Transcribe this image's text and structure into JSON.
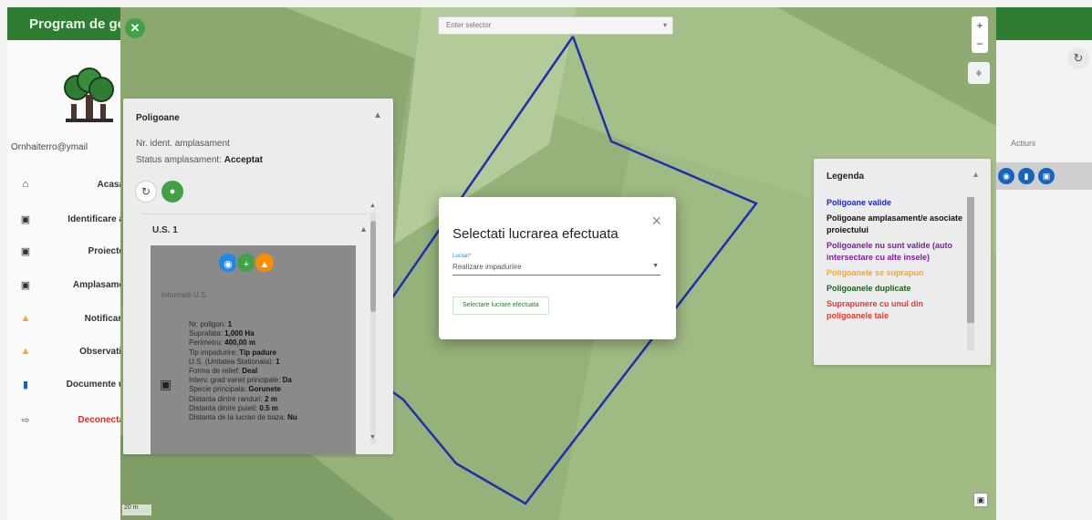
{
  "app": {
    "title": "Program de gest",
    "user_email": "Ornhaiterro@ymail",
    "refresh_icon": "refresh-icon",
    "actions_column_label": "Actiuni"
  },
  "sidebar": {
    "items": [
      {
        "label": "Acasa",
        "icon": "home-icon"
      },
      {
        "label": "Identificare a",
        "icon": "polygon-select-icon"
      },
      {
        "label": "Proiecte",
        "icon": "polygon-select-icon"
      },
      {
        "label": "Amplasame",
        "icon": "polygon-select-icon"
      },
      {
        "label": "Notificari",
        "icon": "bell-icon"
      },
      {
        "label": "Observatii",
        "icon": "warning-icon"
      },
      {
        "label": "Documente u",
        "icon": "document-icon"
      },
      {
        "label": "Deconecta",
        "icon": "logout-icon"
      }
    ]
  },
  "map": {
    "layer_select_placeholder": "Enter selector",
    "zoom_in": "+",
    "zoom_out": "−",
    "scale": "20 m",
    "polygon_color": "#1f2fb0"
  },
  "panel": {
    "title": "Poligoane",
    "ident_label": "Nr. ident. amplasament",
    "status_label": "Status amplasament:",
    "status_value": "Acceptat",
    "us_title": "U.S. 1",
    "card_subtitle": "Informatii U.S.",
    "details": [
      {
        "label": "Nr. poligon:",
        "value": "1"
      },
      {
        "label": "Suprafata:",
        "value": "1,000 Ha"
      },
      {
        "label": "Perimetru:",
        "value": "400,00 m"
      },
      {
        "label": "Tip impadurire:",
        "value": "Tip padure"
      },
      {
        "label": "U.S. (Unitatea Stationala):",
        "value": "1"
      },
      {
        "label": "Forma de relief:",
        "value": "Deal"
      },
      {
        "label": "Interv. grad variet principale:",
        "value": "Da"
      },
      {
        "label": "Specie principala:",
        "value": "Gorunete"
      },
      {
        "label": "Distanta dintre randuri:",
        "value": "2 m"
      },
      {
        "label": "Distanta dintre puieti:",
        "value": "0.5 m"
      },
      {
        "label": "Distanta de la lucrari de baza:",
        "value": "Nu"
      }
    ]
  },
  "legend": {
    "title": "Legenda",
    "items": [
      {
        "label": "Poligoane valide",
        "color": "#1a27c9"
      },
      {
        "label": "Poligoane amplasament/e asociate proiectului",
        "color": "#111111"
      },
      {
        "label": "Poligoanele nu sunt valide (auto intersectare cu alte insele)",
        "color": "#7b1fa2"
      },
      {
        "label": "Poligoanele se suprapun",
        "color": "#f9a825"
      },
      {
        "label": "Poligoanele duplicate",
        "color": "#1b5e20"
      },
      {
        "label": "Suprapunere cu unul din poligoanele tale",
        "color": "#e53935"
      }
    ]
  },
  "dialog": {
    "title": "Selectati lucrarea efectuata",
    "field_label": "Lucrari*",
    "field_value": "Realizare impaduriire",
    "button_label": "Selectare lucrare efectuata",
    "close_symbol": "×"
  }
}
